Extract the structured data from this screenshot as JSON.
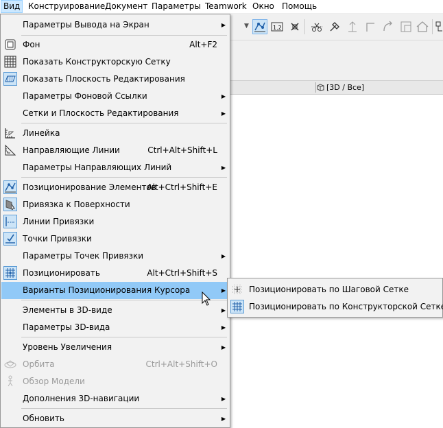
{
  "menubar": {
    "items": [
      "Вид",
      "Конструирование",
      "Документ",
      "Параметры",
      "Teamwork",
      "Окно",
      "Помощь"
    ]
  },
  "tabbar": {
    "view_tab": "[3D / Все]"
  },
  "toolbar": {
    "icons": [
      "dropdown-arrow-icon",
      "positioning-icon",
      "dimension-icon",
      "intersection-icon",
      "trim-icon",
      "adjust-icon",
      "elevate-icon",
      "corner-icon",
      "rotate-icon",
      "resize-icon",
      "roof-icon",
      "more-icon"
    ],
    "active_icon": "positioning-icon"
  },
  "menu": {
    "items": [
      {
        "label": "Параметры Вывода на Экран",
        "shortcut": "",
        "submenu": true,
        "icon": ""
      },
      {
        "label": "Фон",
        "shortcut": "Alt+F2",
        "submenu": false,
        "icon": "background-icon"
      },
      {
        "label": "Показать Конструкторскую Сетку",
        "shortcut": "",
        "submenu": false,
        "icon": "grid-icon"
      },
      {
        "label": "Показать Плоскость Редактирования",
        "shortcut": "",
        "submenu": false,
        "icon": "edit-plane-icon"
      },
      {
        "label": "Параметры Фоновой Ссылки",
        "shortcut": "",
        "submenu": true,
        "icon": ""
      },
      {
        "label": "Сетки и Плоскость Редактирования",
        "shortcut": "",
        "submenu": true,
        "icon": ""
      },
      {
        "label": "Линейка",
        "shortcut": "",
        "submenu": false,
        "icon": "ruler-icon"
      },
      {
        "label": "Направляющие Линии",
        "shortcut": "Ctrl+Alt+Shift+L",
        "submenu": false,
        "icon": "guide-lines-icon"
      },
      {
        "label": "Параметры Направляющих Линий",
        "shortcut": "",
        "submenu": true,
        "icon": ""
      },
      {
        "label": "Позиционирование Элементов",
        "shortcut": "Alt+Ctrl+Shift+E",
        "submenu": false,
        "icon": "element-snap-icon"
      },
      {
        "label": "Привязка к Поверхности",
        "shortcut": "",
        "submenu": false,
        "icon": "surface-snap-icon"
      },
      {
        "label": "Линии Привязки",
        "shortcut": "",
        "submenu": false,
        "icon": "snap-lines-icon"
      },
      {
        "label": "Точки Привязки",
        "shortcut": "",
        "submenu": false,
        "icon": "snap-points-icon"
      },
      {
        "label": "Параметры Точек Привязки",
        "shortcut": "",
        "submenu": true,
        "icon": ""
      },
      {
        "label": "Позиционировать",
        "shortcut": "Alt+Ctrl+Shift+S",
        "submenu": false,
        "icon": "snap-grid-icon"
      },
      {
        "label": "Варианты Позиционирования Курсора",
        "shortcut": "",
        "submenu": true,
        "icon": ""
      },
      {
        "label": "Элементы в 3D-виде",
        "shortcut": "",
        "submenu": true,
        "icon": ""
      },
      {
        "label": "Параметры 3D-вида",
        "shortcut": "",
        "submenu": true,
        "icon": ""
      },
      {
        "label": "Уровень Увеличения",
        "shortcut": "",
        "submenu": true,
        "icon": ""
      },
      {
        "label": "Орбита",
        "shortcut": "Ctrl+Alt+Shift+O",
        "submenu": false,
        "icon": "orbit-icon",
        "disabled": true
      },
      {
        "label": "Обзор Модели",
        "shortcut": "",
        "submenu": false,
        "icon": "walk-icon",
        "disabled": true
      },
      {
        "label": "Дополнения 3D-навигации",
        "shortcut": "",
        "submenu": true,
        "icon": ""
      },
      {
        "label": "Обновить",
        "shortcut": "",
        "submenu": true,
        "icon": ""
      }
    ]
  },
  "submenu": {
    "items": [
      {
        "label": "Позиционировать по Шаговой Сетке",
        "icon": "step-grid-icon"
      },
      {
        "label": "Позиционировать по Конструкторской Сетке",
        "icon": "construction-grid-icon"
      }
    ]
  },
  "colors": {
    "menu_bg": "#f2f2f2",
    "highlight": "#91c9f7",
    "icon_active_bg": "#cce4f7",
    "icon_active_border": "#5b9bd5",
    "disabled_text": "#9a9a9a"
  }
}
